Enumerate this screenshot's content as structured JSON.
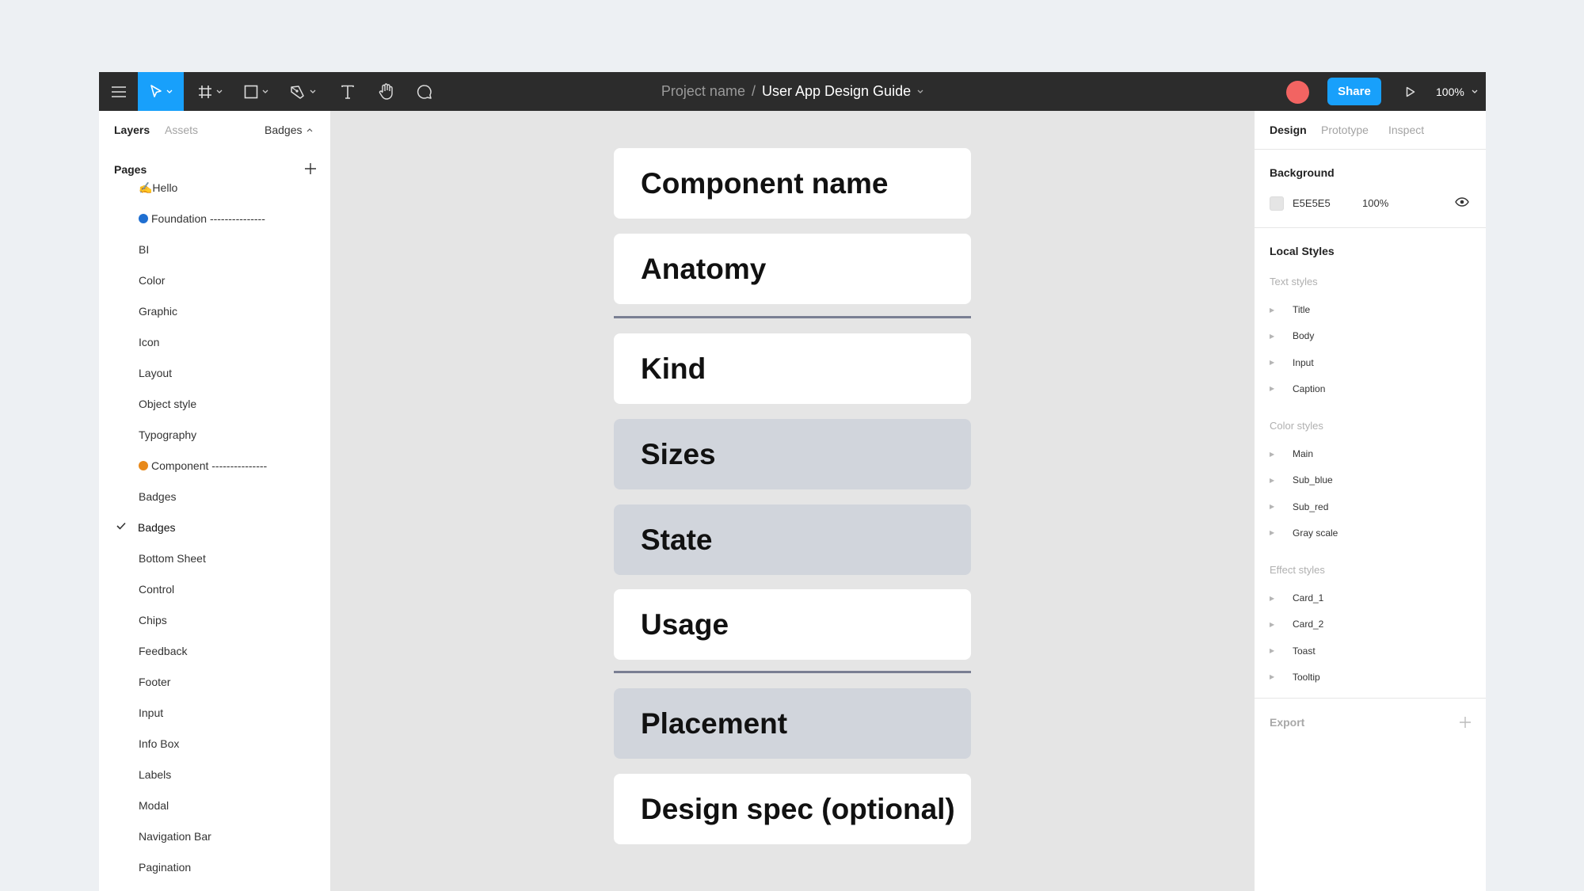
{
  "toolbar": {
    "project_name": "Project name",
    "separator": "/",
    "file_name": "User App Design Guide",
    "share_label": "Share",
    "zoom_level": "100%"
  },
  "left_panel": {
    "tabs": [
      {
        "label": "Layers",
        "active": true
      },
      {
        "label": "Assets",
        "active": false
      }
    ],
    "current_page": "Badges",
    "pages_heading": "Pages",
    "pages": [
      {
        "label": "✍️Hello"
      },
      {
        "label": "Foundation ---------------",
        "dot_color": "#1f6fd1"
      },
      {
        "label": "BI"
      },
      {
        "label": "Color"
      },
      {
        "label": "Graphic"
      },
      {
        "label": "Icon"
      },
      {
        "label": "Layout"
      },
      {
        "label": "Object style"
      },
      {
        "label": "Typography"
      },
      {
        "label": "Component ---------------",
        "dot_color": "#e8891a"
      },
      {
        "label": "Badges"
      },
      {
        "label": "Badges",
        "selected": true
      },
      {
        "label": "Bottom Sheet"
      },
      {
        "label": "Control"
      },
      {
        "label": "Chips"
      },
      {
        "label": "Feedback"
      },
      {
        "label": "Footer"
      },
      {
        "label": "Input"
      },
      {
        "label": "Info Box"
      },
      {
        "label": "Labels"
      },
      {
        "label": "Modal"
      },
      {
        "label": "Navigation Bar"
      },
      {
        "label": "Pagination"
      }
    ]
  },
  "canvas": {
    "background": "#E5E5E5",
    "cards": [
      {
        "label": "Component name",
        "style": "white"
      },
      {
        "label": "Anatomy",
        "style": "white"
      },
      {
        "label": "Kind",
        "style": "white"
      },
      {
        "label": "Sizes",
        "style": "gray"
      },
      {
        "label": "State",
        "style": "gray"
      },
      {
        "label": "Usage",
        "style": "white"
      },
      {
        "label": "Placement",
        "style": "gray"
      },
      {
        "label": "Design spec (optional)",
        "style": "white"
      }
    ]
  },
  "right_panel": {
    "tabs": [
      {
        "label": "Design",
        "active": true
      },
      {
        "label": "Prototype",
        "active": false
      },
      {
        "label": "Inspect",
        "active": false
      }
    ],
    "background_heading": "Background",
    "background_hex": "E5E5E5",
    "background_opacity": "100%",
    "local_styles_heading": "Local Styles",
    "text_styles_heading": "Text styles",
    "text_styles": [
      "Title",
      "Body",
      "Input",
      "Caption"
    ],
    "color_styles_heading": "Color styles",
    "color_styles": [
      "Main",
      "Sub_blue",
      "Sub_red",
      "Gray scale"
    ],
    "effect_styles_heading": "Effect styles",
    "effect_styles": [
      "Card_1",
      "Card_2",
      "Toast",
      "Tooltip"
    ],
    "export_heading": "Export"
  },
  "colors": {
    "toolbar_bg": "#2C2C2C",
    "accent": "#18A0FB",
    "avatar": "#F26462",
    "card_gray": "#D1D5DC",
    "divider": "#7A7F93"
  }
}
